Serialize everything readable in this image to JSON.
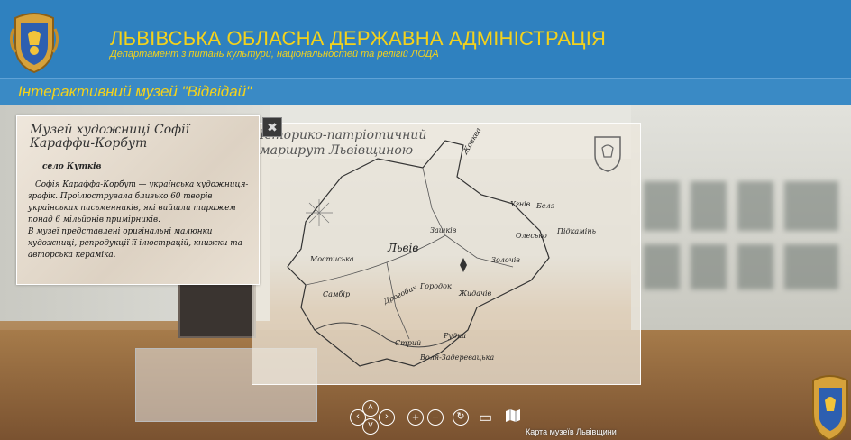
{
  "header": {
    "title": "ЛЬВІВСЬКА ОБЛАСНА ДЕРЖАВНА АДМІНІСТРАЦІЯ",
    "subtitle": "Департамент з питань культури, національностей та релігій ЛОДА",
    "crest_icon": "coat-of-arms-icon"
  },
  "subheader": {
    "title": "Інтерактивний музей \"Відвідай\""
  },
  "info_panel": {
    "title": "Музей художниці Софії Караффи-Корбут",
    "location": "село Кутків",
    "paragraph1": "Софія Караффа-Корбут — українська художниця-графік. Проілюструвала близько 60 творів українських письменників, які вийшли тиражем понад 6 мільйонів примірників.",
    "paragraph2": "В музеї представлені оригінальні малюнки художниці, репродукції її ілюстрацій, книжки та авторська кераміка."
  },
  "map": {
    "title": "Історико-патріотичний\nмаршрут Львівщиною",
    "towns": [
      "Львів",
      "Жовква",
      "Мостиська",
      "Самбір",
      "Дрогобич",
      "Стрий",
      "Рудки",
      "Воля-Задеревацька",
      "Городок",
      "Золочів",
      "Олесько",
      "Підкамінь",
      "Зашків",
      "Жидачів",
      "Угнів",
      "Белз"
    ]
  },
  "controls": {
    "up": "˄",
    "down": "˅",
    "left": "‹",
    "right": "›",
    "zoom_in": "+",
    "zoom_out": "−",
    "autorotate": "↻",
    "fullscreen": "▭",
    "map_icon": "map-icon",
    "map_label": "Карта музеїв Львівщини"
  },
  "colors": {
    "header_bg": "#2f81bf",
    "accent_yellow": "#f3d21c"
  }
}
